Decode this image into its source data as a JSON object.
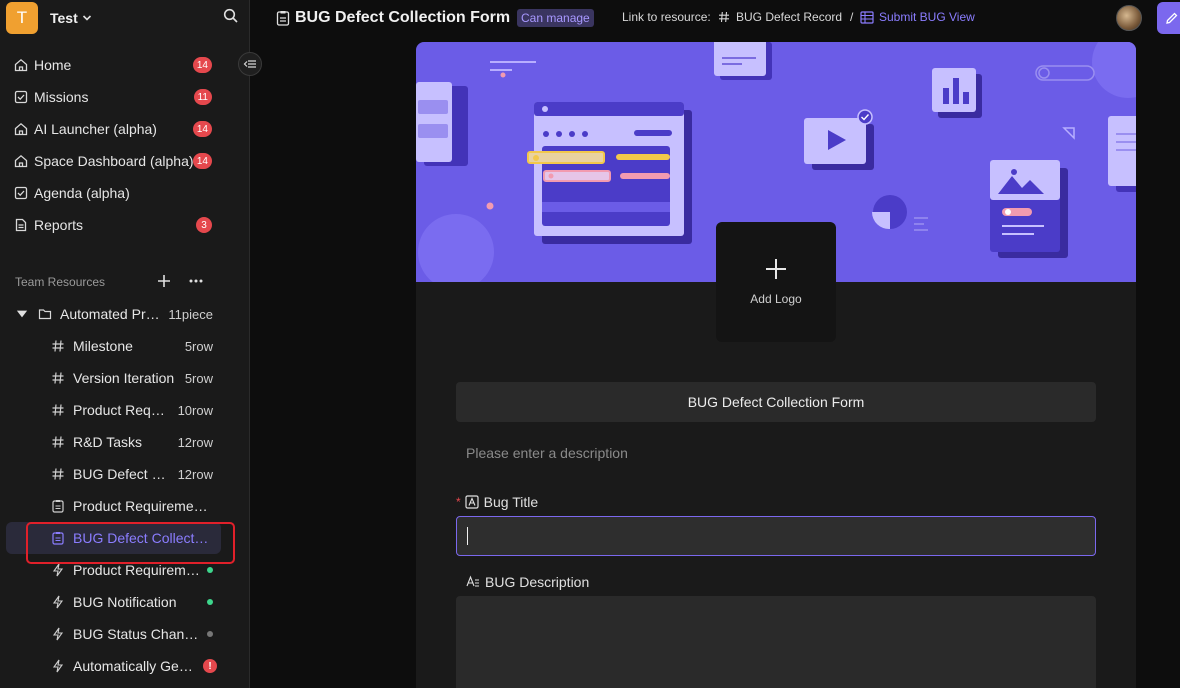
{
  "workspace": {
    "initial": "T",
    "name": "Test"
  },
  "nav": {
    "items": [
      {
        "label": "Home",
        "badge": "14"
      },
      {
        "label": "Missions",
        "badge": "11"
      },
      {
        "label": "AI Launcher (alpha)",
        "badge": "14"
      },
      {
        "label": "Space Dashboard (alpha)",
        "badge": "14"
      },
      {
        "label": "Agenda (alpha)",
        "badge": ""
      },
      {
        "label": "Reports",
        "badge": "3"
      }
    ]
  },
  "team": {
    "title": "Team Resources"
  },
  "tree": {
    "folder": {
      "label": "Automated Pr…",
      "count": "11piece"
    },
    "items": [
      {
        "label": "Milestone",
        "count": "5row"
      },
      {
        "label": "Version Iteration",
        "count": "5row"
      },
      {
        "label": "Product Req…",
        "count": "10row"
      },
      {
        "label": "R&D Tasks",
        "count": "12row"
      },
      {
        "label": "BUG Defect …",
        "count": "12row"
      },
      {
        "label": "Product Requireme…"
      },
      {
        "label": "BUG Defect Collect…"
      },
      {
        "label": "Product Requirem…"
      },
      {
        "label": "BUG Notification"
      },
      {
        "label": "BUG Status Chan…"
      },
      {
        "label": "Automatically Ge…",
        "warn": "!"
      }
    ]
  },
  "colors": {
    "accent": "#7b68ee",
    "badge": "#e5484d",
    "dot_green": "#3dd68c",
    "dot_gray": "#777777"
  },
  "topbar": {
    "title": "BUG Defect Collection Form",
    "permission": "Can manage",
    "link_label": "Link to resource:",
    "link_record": "BUG Defect Record",
    "link_sep": "/",
    "link_view": "Submit BUG View"
  },
  "form": {
    "add_logo": "Add Logo",
    "title": "BUG Defect Collection Form",
    "description_placeholder": "Please enter a description",
    "fields": [
      {
        "required": "*",
        "label": "Bug Title",
        "value": ""
      },
      {
        "label": "BUG Description",
        "value": ""
      }
    ]
  }
}
